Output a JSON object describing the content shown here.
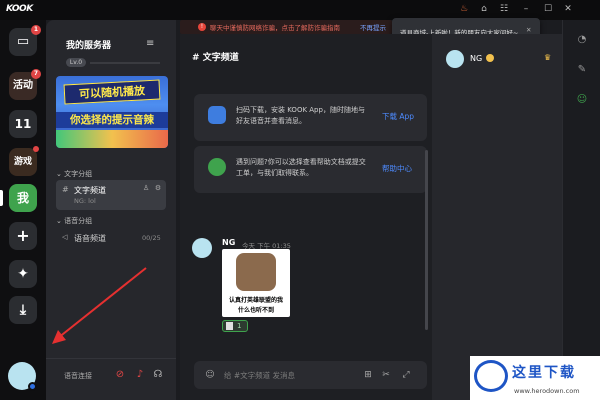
{
  "app": {
    "logo": "KOOK",
    "accent": "#3fa34d",
    "link_color": "#4d8bff"
  },
  "titlebar": {
    "banner_text": "聊天中谨慎防网络诈骗，点击了解防诈骗指南",
    "banner_link": "不再提示",
    "tooltip_text": "道具商城-上新啦！新的朋友向大家问好~",
    "controls": [
      "shirt-icon",
      "minimize-icon",
      "maximize-icon",
      "close-icon"
    ]
  },
  "servers": [
    {
      "label": "",
      "icon": "chat-icon",
      "badge": "1"
    },
    {
      "label": "活动",
      "badge": "7"
    },
    {
      "label": "11"
    },
    {
      "label": "游戏",
      "dot": true
    },
    {
      "label": "我",
      "active": true
    },
    {
      "label": "+",
      "icon": "plus-icon"
    },
    {
      "label": "✦",
      "icon": "sparkle-icon"
    },
    {
      "label": "⤓",
      "icon": "download-icon"
    }
  ],
  "sidebar": {
    "server_title": "我的服务器",
    "level": "Lv.0",
    "promo_line1": "可以随机播放",
    "promo_line2": "你选择的提示音辣",
    "text_category": "文字分组",
    "text_channel": {
      "name": "文字频道",
      "sub": "NG: lol"
    },
    "voice_category": "语音分组",
    "voice_channel": {
      "name": "语音频道",
      "count": "00/25"
    },
    "voice_connect": "语音连接"
  },
  "main": {
    "channel_title": "文字频道",
    "card1": {
      "text": "扫码下载，安装 KOOK App，随时随地与好友语音并查看消息。",
      "action": "下载 App"
    },
    "card2": {
      "text": "遇到问题?你可以选择查看帮助文档或提交工单，与我们取得联系。",
      "action": "帮助中心"
    },
    "message": {
      "author": "NG",
      "time": "今天 下午 01:35",
      "meme_line1": "认真打英雄联盟的我",
      "meme_line2": "什么也听不到",
      "reaction_count": "1"
    },
    "composer_placeholder": "给 #文字频道 发消息"
  },
  "members": {
    "name": "NG"
  },
  "watermark": {
    "title": "这里下载",
    "url": "www.herodown.com"
  }
}
